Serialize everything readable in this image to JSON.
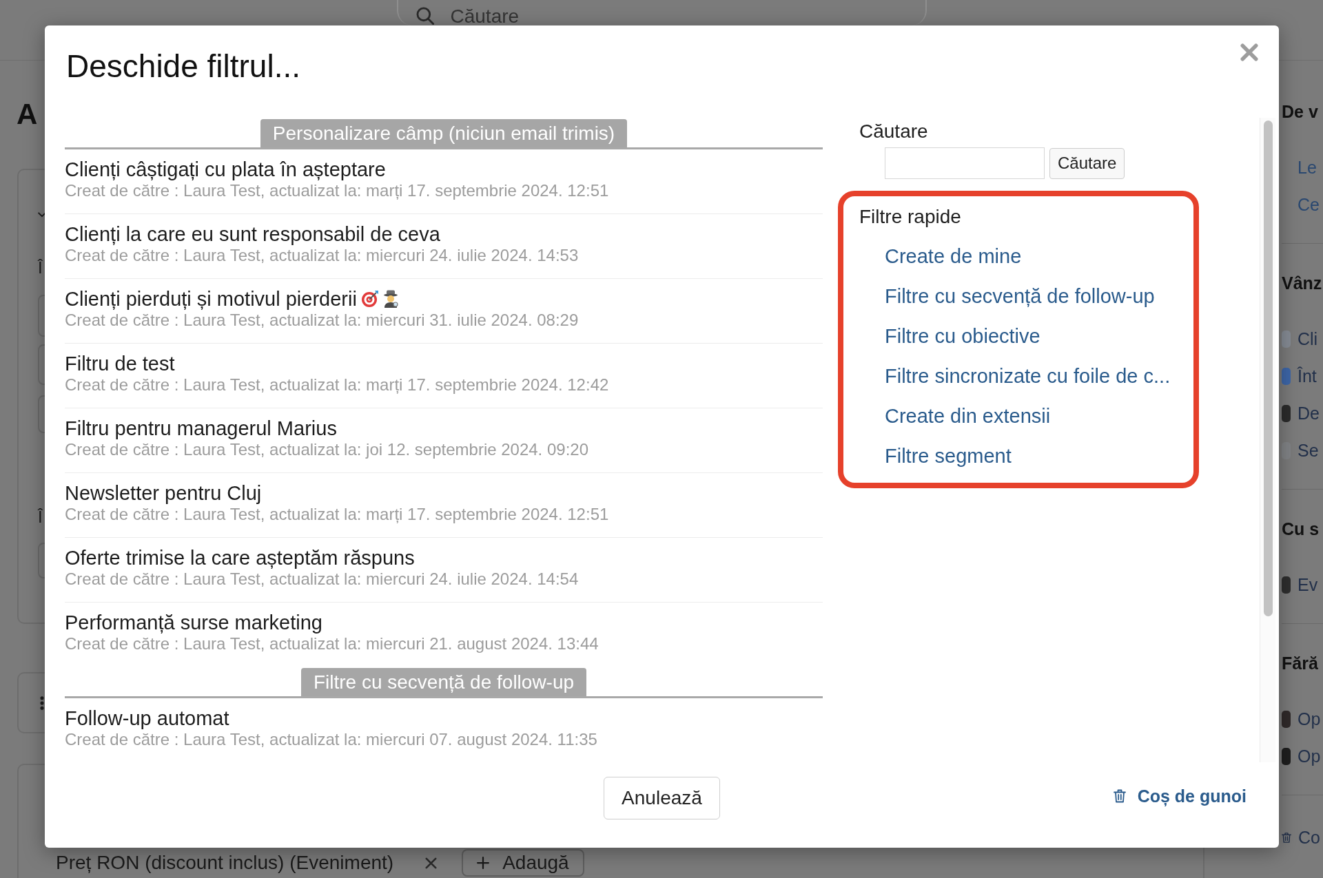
{
  "background": {
    "search_field": {
      "placeholder": "Căutare"
    },
    "page_title": "A",
    "form_card": {
      "labels": [
        "Î",
        "Î"
      ]
    },
    "price_field": {
      "label": "Preț RON (discount inclus) (Eveniment)",
      "add_button": "Adaugă"
    },
    "sidebar": {
      "sections": [
        {
          "title": "De v",
          "items": [
            {
              "kind": "link",
              "label": "Le"
            },
            {
              "kind": "link",
              "label": "Ce"
            }
          ]
        },
        {
          "title": "Vânz",
          "items": [
            {
              "kind": "swatch",
              "label": "Cli",
              "color": "#858b94"
            },
            {
              "kind": "swatch",
              "label": "Înt",
              "color": "#3d66a8"
            },
            {
              "kind": "swatch",
              "label": "De",
              "color": "#2b2b2b"
            },
            {
              "kind": "swatch",
              "label": "Se",
              "color": "#818386"
            }
          ]
        },
        {
          "title": "Cu s",
          "items": [
            {
              "kind": "swatch",
              "label": "Ev",
              "color": "#2e2e2e"
            }
          ]
        },
        {
          "title": "Fără",
          "items": [
            {
              "kind": "swatch",
              "label": "Op",
              "color": "#302a2a"
            },
            {
              "kind": "swatch",
              "label": "Op",
              "color": "#1e1e1e"
            }
          ]
        }
      ],
      "footer_link": "Co"
    }
  },
  "dialog": {
    "title": "Deschide filtrul...",
    "groups": [
      {
        "title": "Personalizare câmp (niciun email trimis)",
        "filters": [
          {
            "name": "Clienți câștigați cu plata în așteptare",
            "meta": "Creat de către : Laura Test, actualizat la: marți 17. septembrie 2024. 12:51"
          },
          {
            "name": "Clienți la care eu sunt responsabil de ceva",
            "meta": "Creat de către : Laura Test, actualizat la: miercuri 24. iulie 2024. 14:53"
          },
          {
            "name": "Clienți pierduți și motivul pierderii",
            "icons": [
              {
                "kind": "target"
              },
              {
                "kind": "detective"
              }
            ],
            "meta": "Creat de către : Laura Test, actualizat la: miercuri 31. iulie 2024. 08:29"
          },
          {
            "name": "Filtru de test",
            "meta": "Creat de către : Laura Test, actualizat la: marți 17. septembrie 2024. 12:42"
          },
          {
            "name": "Filtru pentru managerul Marius",
            "meta": "Creat de către : Laura Test, actualizat la: joi 12. septembrie 2024. 09:20"
          },
          {
            "name": "Newsletter pentru Cluj",
            "meta": "Creat de către : Laura Test, actualizat la: marți 17. septembrie 2024. 12:51"
          },
          {
            "name": "Oferte trimise la care așteptăm răspuns",
            "meta": "Creat de către : Laura Test, actualizat la: miercuri 24. iulie 2024. 14:54"
          },
          {
            "name": "Performanță surse marketing",
            "meta": "Creat de către : Laura Test, actualizat la: miercuri 21. august 2024. 13:44"
          }
        ]
      },
      {
        "title": "Filtre cu secvență de follow-up",
        "filters": [
          {
            "name": "Follow-up automat",
            "meta": "Creat de către : Laura Test, actualizat la: miercuri 07. august 2024. 11:35"
          }
        ]
      }
    ],
    "search": {
      "label": "Căutare",
      "button": "Căutare"
    },
    "quick_filters": {
      "title": "Filtre rapide",
      "links": [
        "Create de mine",
        "Filtre cu secvență de follow-up",
        "Filtre cu obiective",
        "Filtre sincronizate cu foile de c...",
        "Create din extensii",
        "Filtre segment"
      ]
    },
    "cancel_button": "Anulează",
    "trash_link": "Coș de gunoi"
  }
}
